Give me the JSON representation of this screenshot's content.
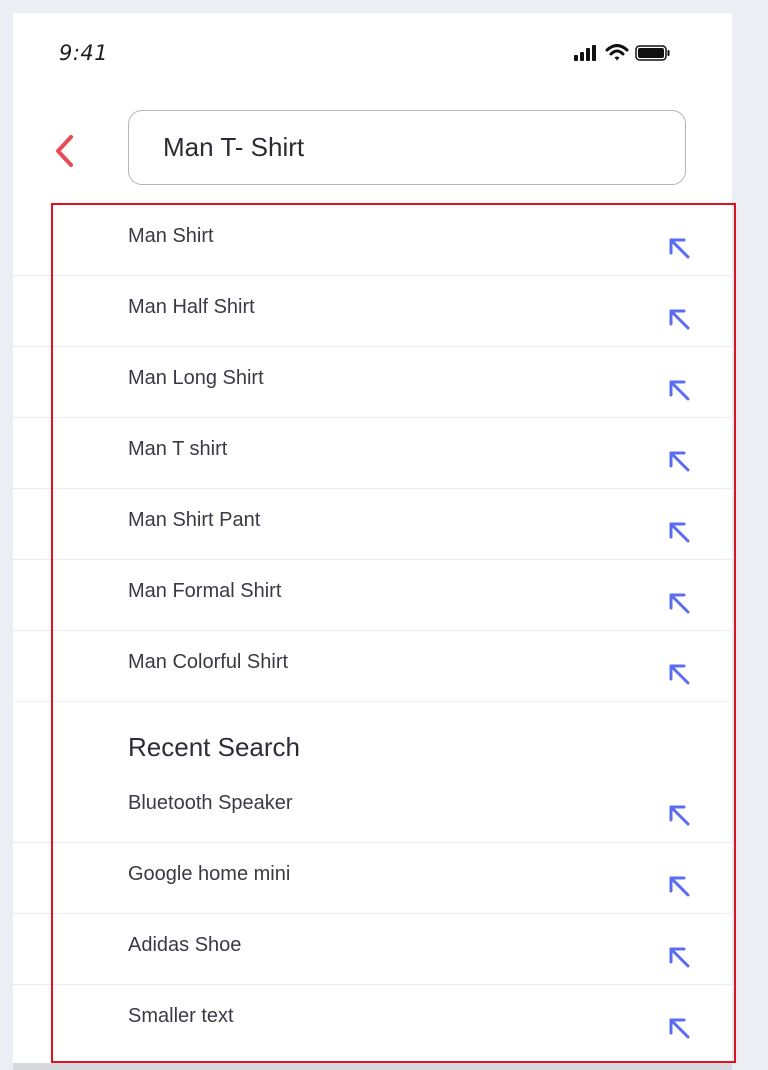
{
  "status": {
    "time": "9:41"
  },
  "search": {
    "value": "Man T- Shirt"
  },
  "suggestions": [
    {
      "label": "Man Shirt"
    },
    {
      "label": "Man Half Shirt"
    },
    {
      "label": "Man Long Shirt"
    },
    {
      "label": "Man T shirt"
    },
    {
      "label": "Man Shirt Pant"
    },
    {
      "label": "Man Formal Shirt"
    },
    {
      "label": "Man Colorful Shirt"
    }
  ],
  "recent": {
    "title": "Recent Search",
    "items": [
      {
        "label": "Bluetooth Speaker"
      },
      {
        "label": "Google home mini"
      },
      {
        "label": "Adidas Shoe"
      },
      {
        "label": "Smaller text"
      }
    ]
  },
  "colors": {
    "accent": "#e84a57",
    "arrow": "#5a6df0",
    "highlight": "#e0121f"
  },
  "icons": {
    "back": "chevron-left-icon",
    "fill": "arrow-up-left-icon"
  }
}
